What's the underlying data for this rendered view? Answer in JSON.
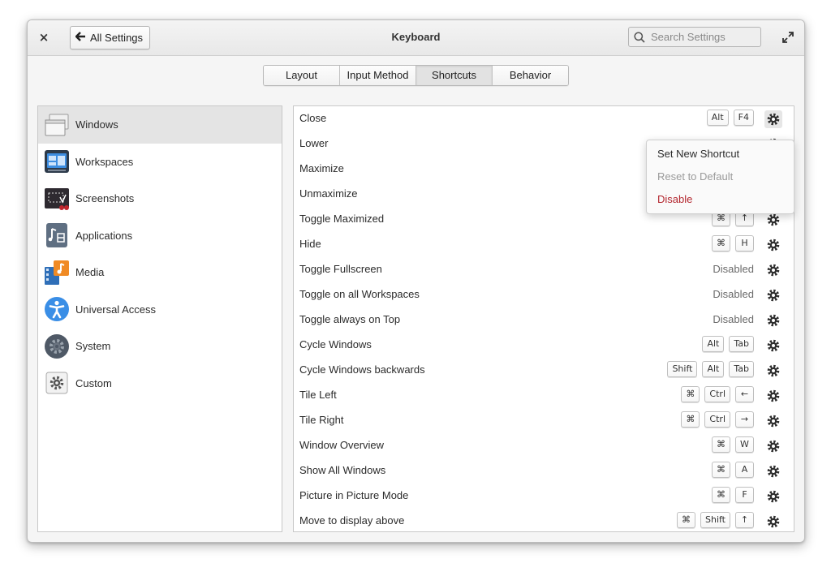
{
  "window": {
    "title": "Keyboard",
    "back_label": "All Settings",
    "close_glyph": "×",
    "back_arrow_glyph": "🡐"
  },
  "search": {
    "placeholder": "Search Settings",
    "value": ""
  },
  "tabs": [
    {
      "label": "Layout",
      "active": false
    },
    {
      "label": "Input Method",
      "active": false
    },
    {
      "label": "Shortcuts",
      "active": true
    },
    {
      "label": "Behavior",
      "active": false
    }
  ],
  "sidebar": {
    "items": [
      {
        "label": "Windows",
        "icon": "windows-icon",
        "selected": true
      },
      {
        "label": "Workspaces",
        "icon": "workspaces-icon",
        "selected": false
      },
      {
        "label": "Screenshots",
        "icon": "screenshots-icon",
        "selected": false
      },
      {
        "label": "Applications",
        "icon": "applications-icon",
        "selected": false
      },
      {
        "label": "Media",
        "icon": "media-icon",
        "selected": false
      },
      {
        "label": "Universal Access",
        "icon": "universal-access-icon",
        "selected": false
      },
      {
        "label": "System",
        "icon": "system-icon",
        "selected": false
      },
      {
        "label": "Custom",
        "icon": "custom-icon",
        "selected": false
      }
    ]
  },
  "shortcuts": [
    {
      "label": "Close",
      "keys": [
        "Alt",
        "F4"
      ],
      "disabled": false
    },
    {
      "label": "Lower",
      "keys": [],
      "disabled": false
    },
    {
      "label": "Maximize",
      "keys": [],
      "disabled": false
    },
    {
      "label": "Unmaximize",
      "keys": [],
      "disabled": false
    },
    {
      "label": "Toggle Maximized",
      "keys": [
        "⌘",
        "↑"
      ],
      "disabled": false
    },
    {
      "label": "Hide",
      "keys": [
        "⌘",
        "H"
      ],
      "disabled": false
    },
    {
      "label": "Toggle Fullscreen",
      "keys": [],
      "disabled": true
    },
    {
      "label": "Toggle on all Workspaces",
      "keys": [],
      "disabled": true
    },
    {
      "label": "Toggle always on Top",
      "keys": [],
      "disabled": true
    },
    {
      "label": "Cycle Windows",
      "keys": [
        "Alt",
        "Tab"
      ],
      "disabled": false
    },
    {
      "label": "Cycle Windows backwards",
      "keys": [
        "Shift",
        "Alt",
        "Tab"
      ],
      "disabled": false
    },
    {
      "label": "Tile Left",
      "keys": [
        "⌘",
        "Ctrl",
        "←"
      ],
      "disabled": false
    },
    {
      "label": "Tile Right",
      "keys": [
        "⌘",
        "Ctrl",
        "→"
      ],
      "disabled": false
    },
    {
      "label": "Window Overview",
      "keys": [
        "⌘",
        "W"
      ],
      "disabled": false
    },
    {
      "label": "Show All Windows",
      "keys": [
        "⌘",
        "A"
      ],
      "disabled": false
    },
    {
      "label": "Picture in Picture Mode",
      "keys": [
        "⌘",
        "F"
      ],
      "disabled": false
    },
    {
      "label": "Move to display above",
      "keys": [
        "⌘",
        "Shift",
        "↑"
      ],
      "disabled": false
    }
  ],
  "disabled_label": "Disabled",
  "popover": {
    "set_new": "Set New Shortcut",
    "reset": "Reset to Default",
    "disable": "Disable"
  },
  "colors": {
    "accent_red": "#b3262e",
    "selected_bg": "#e4e4e4"
  }
}
